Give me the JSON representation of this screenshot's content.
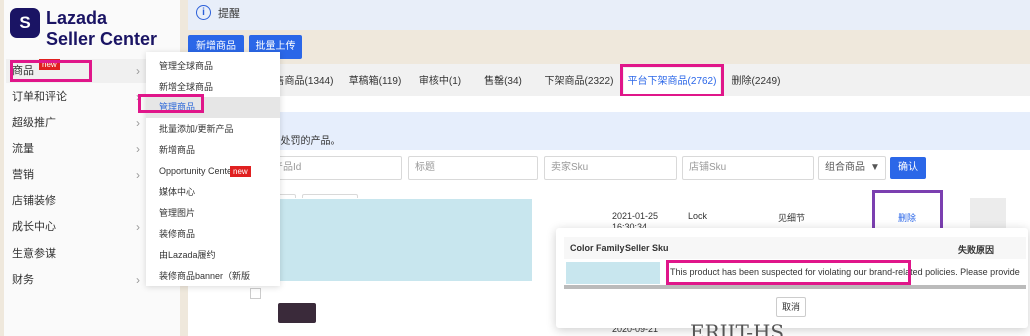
{
  "sidebar": {
    "logo_mark": "S",
    "logo_line1": "Lazada",
    "logo_line2": "Seller Center",
    "new_badge": "new",
    "items": [
      {
        "label": "商品",
        "chevron": "›"
      },
      {
        "label": "订单和评论",
        "chevron": "›"
      },
      {
        "label": "超级推广",
        "chevron": "›"
      },
      {
        "label": "流量",
        "chevron": "›"
      },
      {
        "label": "营销",
        "chevron": "›"
      },
      {
        "label": "店铺装修",
        "chevron": ""
      },
      {
        "label": "成长中心",
        "chevron": "›"
      },
      {
        "label": "生意参谋",
        "chevron": ""
      },
      {
        "label": "财务",
        "chevron": "›"
      }
    ]
  },
  "submenu": {
    "items": [
      "管理全球商品",
      "新增全球商品",
      "管理商品",
      "批量添加/更新产品",
      "新增商品",
      "Opportunity Center",
      "媒体中心",
      "管理图片",
      "装修商品",
      "由Lazada履约",
      "装修商品banner（新版"
    ],
    "new_badge": "new"
  },
  "notice": {
    "title": "提醒",
    "icon": "info-icon",
    "text": "SKU处罚的产品。"
  },
  "actions": {
    "add_product": "新增商品",
    "bulk_upload": "批量上传"
  },
  "tabs": [
    "售商品(1344)",
    "草稿箱(119)",
    "审核中(1)",
    "售罄(34)",
    "下架商品(2322)",
    "平台下架商品(2762)",
    "删除(2249)"
  ],
  "filters": {
    "product_id": "产品Id",
    "title": "标题",
    "seller_sku": "卖家Sku",
    "shop_sku": "店铺Sku",
    "combo": "组合商品",
    "confirm": "确认"
  },
  "table": {
    "row1": {
      "date": "2021-01-25",
      "time": "16:30:34",
      "status": "Lock",
      "reason": "见细节",
      "delete": "删除"
    },
    "row2": {
      "date": "2020-09-21"
    }
  },
  "popup": {
    "col_color_family": "Color Family",
    "col_seller_sku": "Seller Sku",
    "col_reason": "失败原因",
    "message": "This product has been suspected for violating our brand-related policies. Please provide authorization lett",
    "cancel": "取消"
  },
  "bottom_text": "ERIIT-HS",
  "colors": {
    "brand": "#1a1464",
    "accent": "#2b67e8",
    "highlight": "#e0168a",
    "highlight_alt": "#7b3fb0"
  }
}
